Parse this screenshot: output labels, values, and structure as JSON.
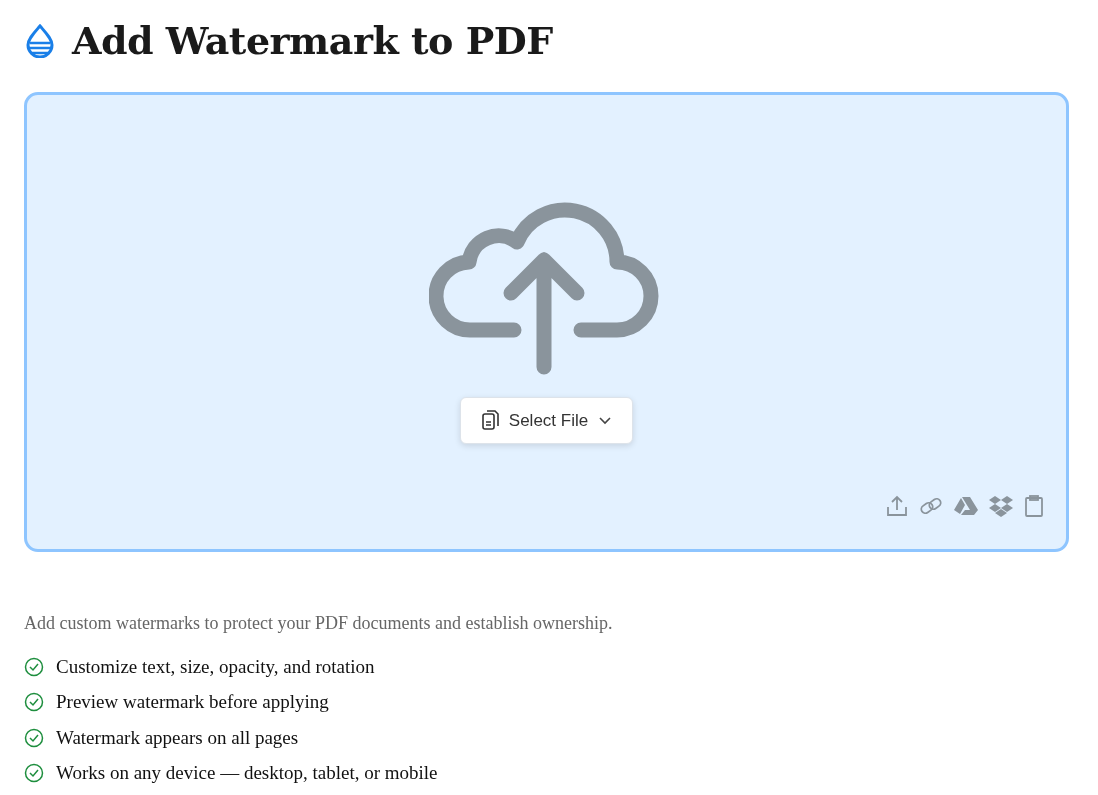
{
  "title": "Add Watermark to PDF",
  "dropzone": {
    "select_button": {
      "label": "Select File"
    }
  },
  "description": "Add custom watermarks to protect your PDF documents and establish ownership.",
  "features": [
    "Customize text, size, opacity, and rotation",
    "Preview watermark before applying",
    "Watermark appears on all pages",
    "Works on any device — desktop, tablet, or mobile"
  ]
}
